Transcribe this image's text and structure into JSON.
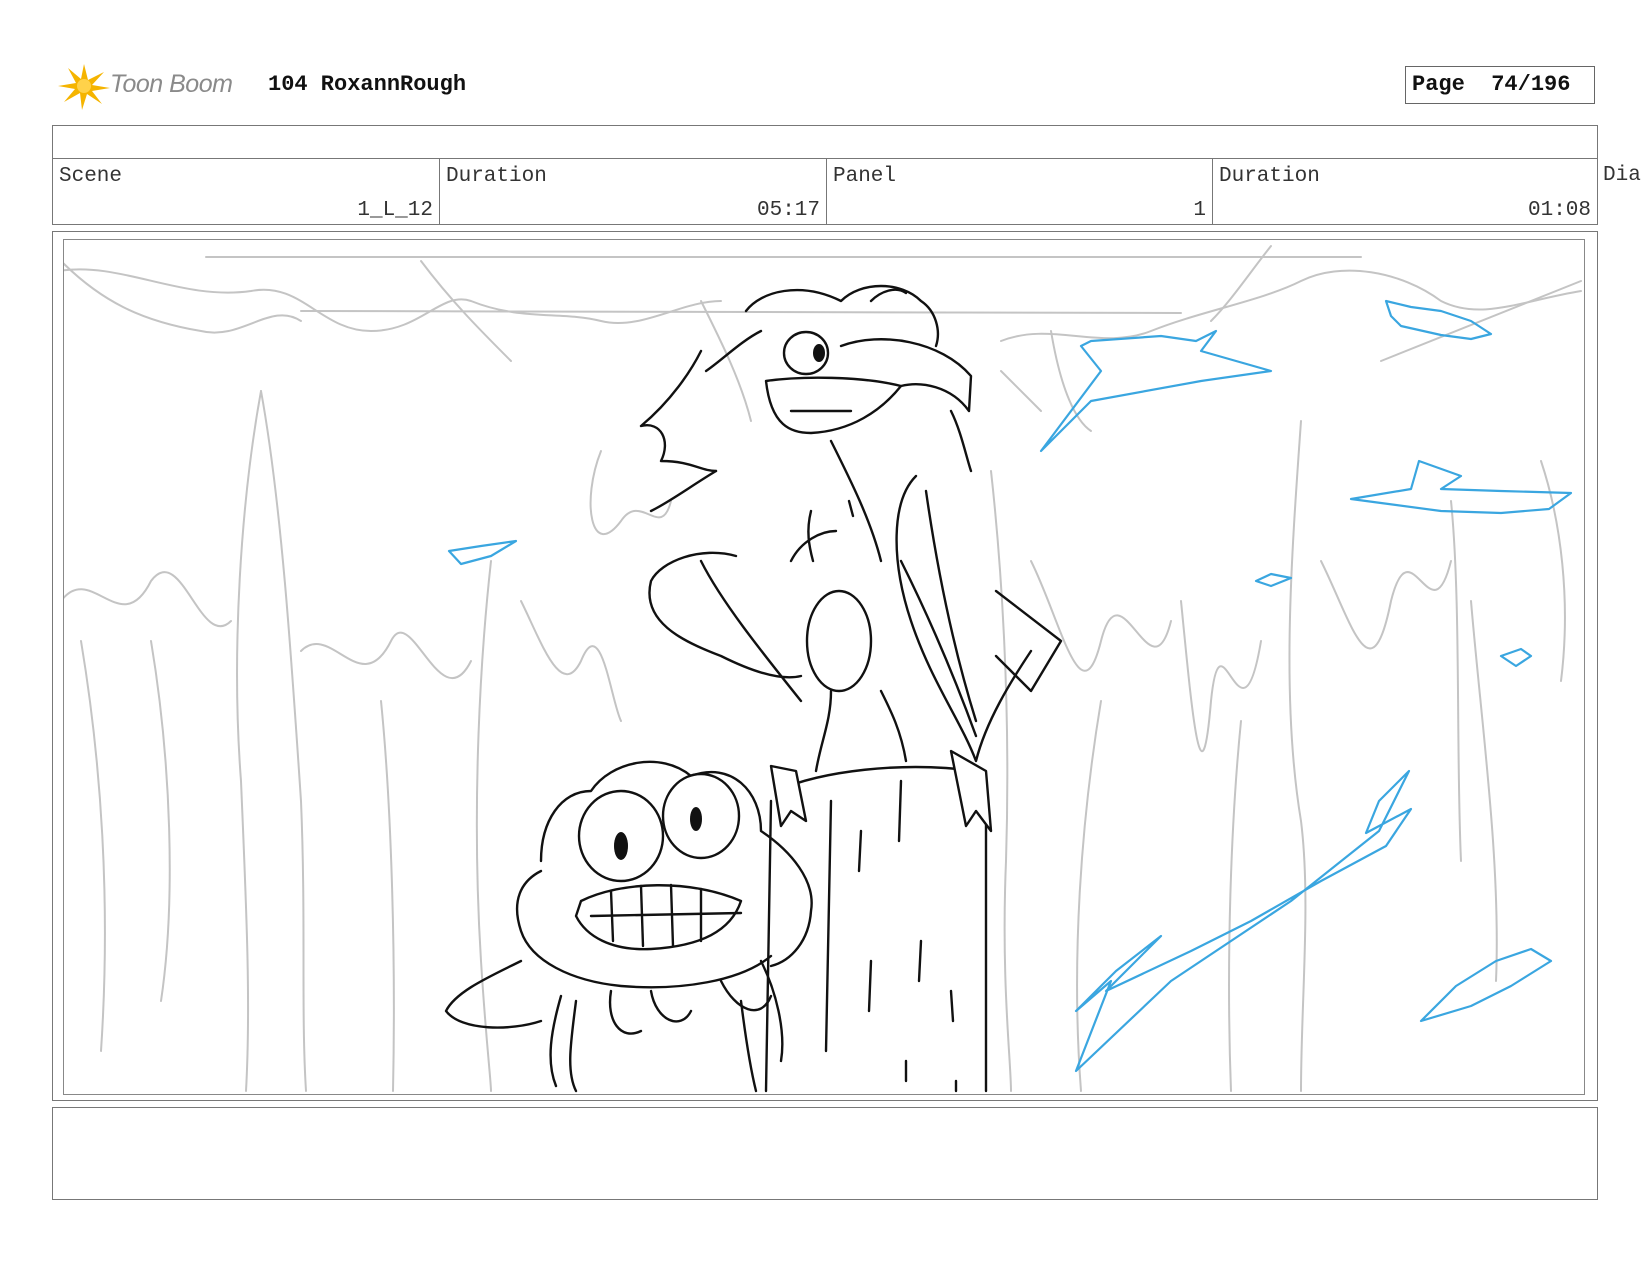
{
  "header": {
    "logo_text": "Toon Boom",
    "project_title": "104 RoxannRough",
    "page_label": "Page",
    "page_value": "74/196"
  },
  "info": {
    "scene_label": "Scene",
    "scene_value": "1_L_12",
    "scene_duration_label": "Duration",
    "scene_duration_value": "05:17",
    "panel_label": "Panel",
    "panel_value": "1",
    "panel_duration_label": "Duration",
    "panel_duration_value": "01:08",
    "dialogue_label_partial": "Dia"
  },
  "colors": {
    "logo_star": "#f5b400",
    "sketch_black": "#111111",
    "sketch_blue": "#3aa6e0",
    "sketch_grey": "#c4c4c4"
  }
}
